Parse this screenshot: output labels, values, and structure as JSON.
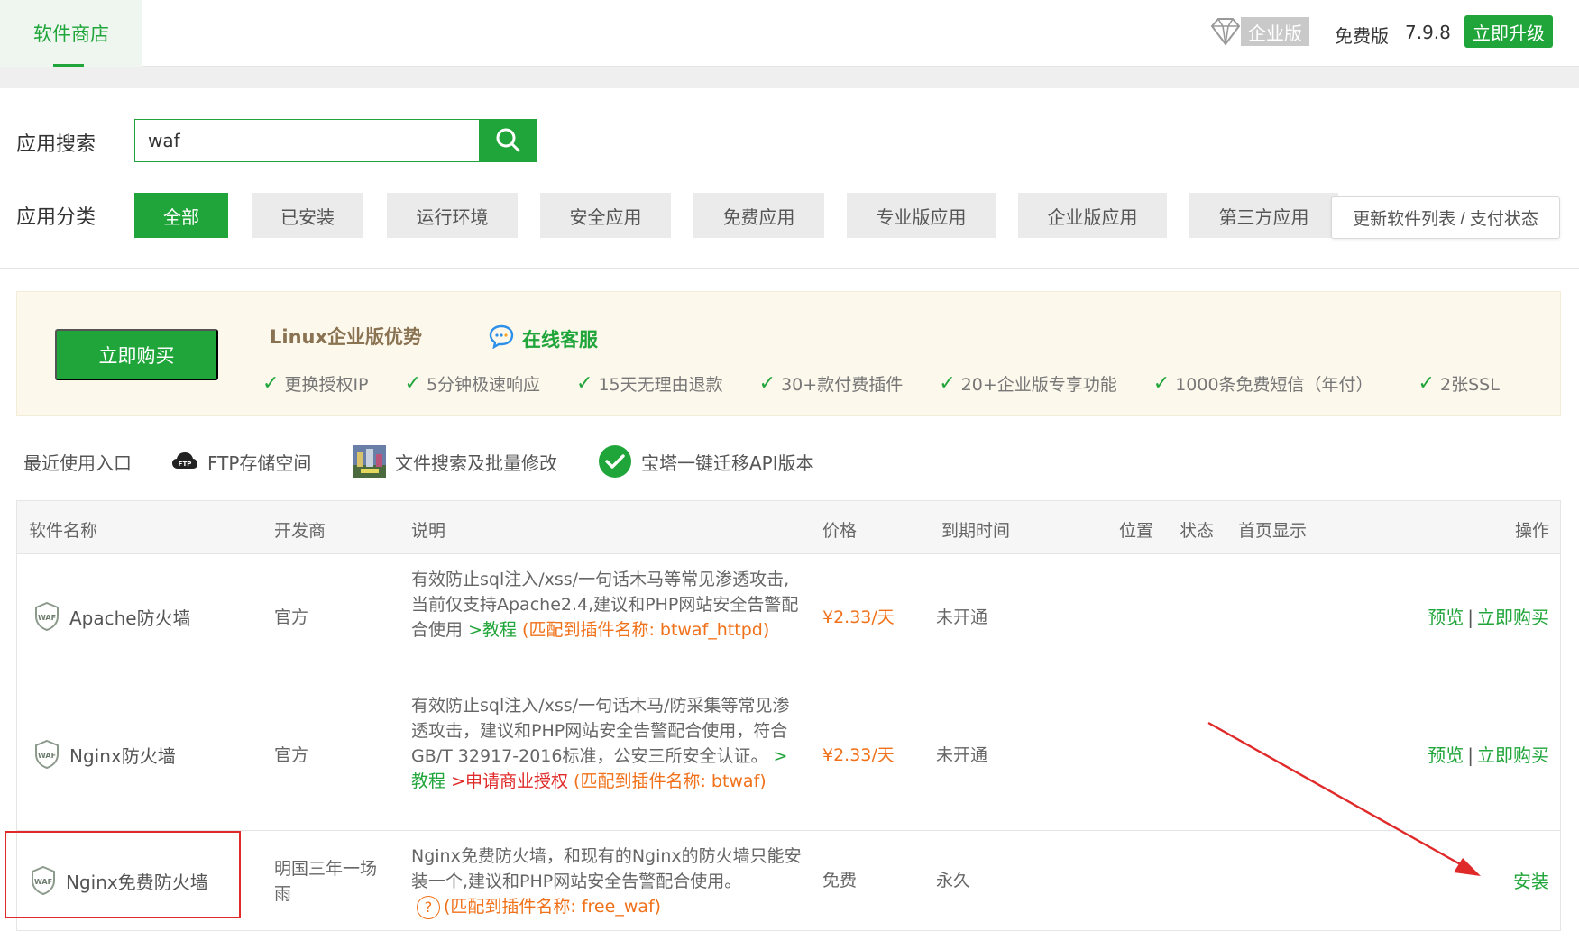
{
  "topbar": {
    "tab_label": "软件商店",
    "enterprise_label": "企业版",
    "free_label": "免费版",
    "version": "7.9.8",
    "upgrade_label": "立即升级"
  },
  "search": {
    "label": "应用搜索",
    "value": "waf",
    "icon": "search-icon"
  },
  "categories": {
    "label": "应用分类",
    "items": [
      "全部",
      "已安装",
      "运行环境",
      "安全应用",
      "免费应用",
      "专业版应用",
      "企业版应用",
      "第三方应用"
    ],
    "active": "全部",
    "refresh_label": "更新软件列表 / 支付状态"
  },
  "promo": {
    "buy_label": "立即购买",
    "title": "Linux企业版优势",
    "online_service": "在线客服",
    "benefits": [
      "更换授权IP",
      "5分钟极速响应",
      "15天无理由退款",
      "30+款付费插件",
      "20+企业版专享功能",
      "1000条免费短信（年付）",
      "2张SSL"
    ]
  },
  "recent": {
    "label": "最近使用入口",
    "items": [
      {
        "label": "FTP存储空间",
        "icon": "ftp-cloud-icon"
      },
      {
        "label": "文件搜索及批量修改",
        "icon": "file-search-icon"
      },
      {
        "label": "宝塔一键迁移API版本",
        "icon": "check-circle-icon"
      }
    ]
  },
  "table": {
    "headers": {
      "name": "软件名称",
      "dev": "开发商",
      "desc": "说明",
      "price": "价格",
      "expire": "到期时间",
      "position": "位置",
      "status": "状态",
      "home": "首页显示",
      "ops": "操作"
    },
    "rows": [
      {
        "name": "Apache防火墙",
        "dev": "官方",
        "desc_text": "有效防止sql注入/xss/一句话木马等常见渗透攻击,当前仅支持Apache2.4,建议和PHP网站安全告警配合使用",
        "tutorial": ">教程",
        "match": "(匹配到插件名称: btwaf_httpd)",
        "price": "¥2.33/天",
        "expire": "未开通",
        "op_preview": "预览",
        "op_sep": "|",
        "op_buy": "立即购买"
      },
      {
        "name": "Nginx防火墙",
        "dev": "官方",
        "desc_text": "有效防止sql注入/xss/一句话木马/防采集等常见渗透攻击，建议和PHP网站安全告警配合使用，符合GB/T 32917-2016标准，公安三所安全认证。",
        "tutorial": ">教程",
        "license": ">申请商业授权",
        "match": "(匹配到插件名称: btwaf)",
        "price": "¥2.33/天",
        "expire": "未开通",
        "op_preview": "预览",
        "op_sep": "|",
        "op_buy": "立即购买"
      },
      {
        "name": "Nginx免费防火墙",
        "dev": "明国三年一场雨",
        "desc_text": "Nginx免费防火墙，和现有的Nginx的防火墙只能安装一个,建议和PHP网站安全告警配合使用。",
        "help_icon": "?",
        "match": "(匹配到插件名称: free_waf)",
        "price": "免费",
        "expire": "永久",
        "op_install": "安装"
      }
    ]
  },
  "colors": {
    "accent": "#20a53a",
    "price": "#f0711a",
    "annotation": "#e02a2a",
    "promo_bg": "#fdf8ec"
  }
}
